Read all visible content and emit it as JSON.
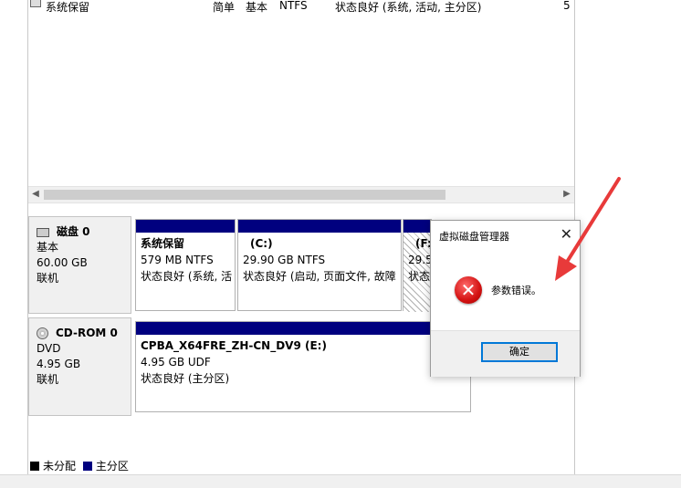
{
  "volume_list": {
    "row": {
      "name": "系统保留",
      "layout": "简单",
      "type": "基本",
      "fs": "NTFS",
      "status": "状态良好 (系统, 活动, 主分区)",
      "cut": "5"
    }
  },
  "disks": [
    {
      "name": "磁盘 0",
      "kind": "基本",
      "size": "60.00 GB",
      "state": "联机",
      "partitions": [
        {
          "title": "系统保留",
          "size": "579 MB NTFS",
          "status": "状态良好 (系统, 活"
        },
        {
          "title": "(C:)",
          "size": "29.90 GB NTFS",
          "status": "状态良好 (启动, 页面文件, 故障"
        },
        {
          "title": "(F:",
          "size": "29.5",
          "status": "状态"
        }
      ]
    },
    {
      "name": "CD-ROM 0",
      "kind": "DVD",
      "size": "4.95 GB",
      "state": "联机",
      "partitions": [
        {
          "title": "CPBA_X64FRE_ZH-CN_DV9  (E:)",
          "size": "4.95 GB UDF",
          "status": "状态良好 (主分区)"
        }
      ]
    }
  ],
  "legend": [
    {
      "label": "未分配",
      "color": "#000000"
    },
    {
      "label": "主分区",
      "color": "#00007f"
    }
  ],
  "dialog": {
    "title": "虚拟磁盘管理器",
    "close_glyph": "✕",
    "icon": "error-icon",
    "icon_glyph": "✕",
    "message": "参数错误。",
    "ok_label": "确定"
  },
  "colors": {
    "partition_bar": "#00007f",
    "arrow": "#e83a3a",
    "focus_border": "#0078d7"
  }
}
